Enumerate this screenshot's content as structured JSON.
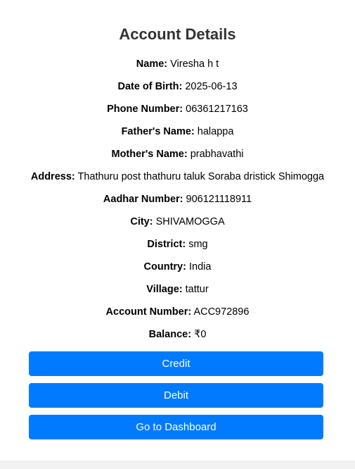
{
  "page": {
    "title": "Account Details"
  },
  "details": [
    {
      "label": "Name:",
      "value": "Viresha h t"
    },
    {
      "label": "Date of Birth:",
      "value": "2025-06-13"
    },
    {
      "label": "Phone Number:",
      "value": "06361217163"
    },
    {
      "label": "Father's Name:",
      "value": "halappa"
    },
    {
      "label": "Mother's Name:",
      "value": "prabhavathi"
    },
    {
      "label": "Address:",
      "value": "Thathuru post thathuru taluk Soraba dristick Shimogga"
    },
    {
      "label": "Aadhar Number:",
      "value": "906121118911"
    },
    {
      "label": "City:",
      "value": "SHIVAMOGGA"
    },
    {
      "label": "District:",
      "value": "smg"
    },
    {
      "label": "Country:",
      "value": "India"
    },
    {
      "label": "Village:",
      "value": "tattur"
    },
    {
      "label": "Account Number:",
      "value": "ACC972896"
    },
    {
      "label": "Balance:",
      "value": "₹0"
    }
  ],
  "buttons": {
    "credit": "Credit",
    "debit": "Debit",
    "dashboard": "Go to Dashboard"
  },
  "colors": {
    "accent": "#007bff",
    "title": "#333333",
    "page_background": "#f2f2f2"
  }
}
